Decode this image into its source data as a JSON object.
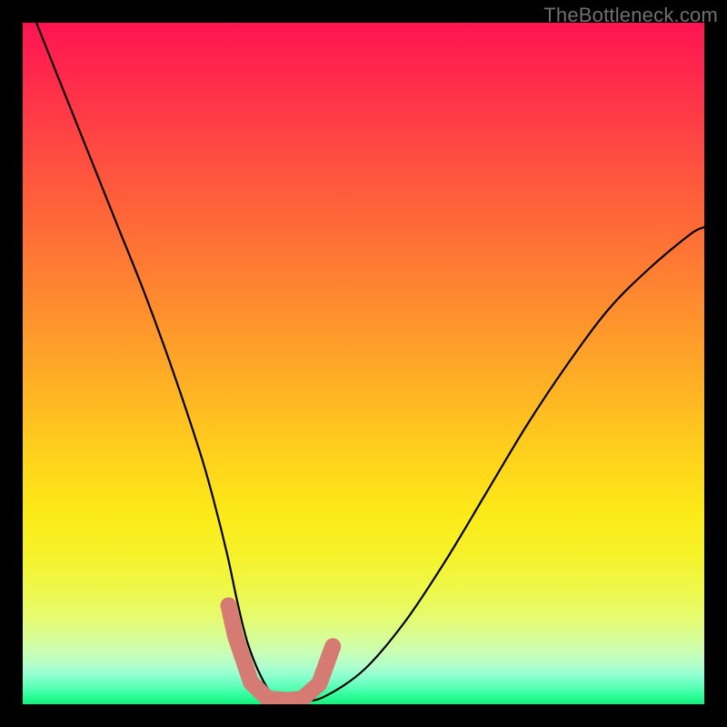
{
  "watermark": "TheBottleneck.com",
  "chart_data": {
    "type": "line",
    "title": "",
    "xlabel": "",
    "ylabel": "",
    "xlim": [
      0,
      100
    ],
    "ylim": [
      0,
      100
    ],
    "series": [
      {
        "name": "bottleneck-curve",
        "x": [
          2,
          6,
          10,
          14,
          18,
          22,
          26,
          28,
          30,
          31.5,
          33,
          35,
          37,
          39,
          40.5,
          44,
          50,
          56,
          62,
          68,
          74,
          80,
          86,
          92,
          98,
          100
        ],
        "y": [
          100,
          90,
          80,
          70,
          60,
          49,
          37,
          30,
          22,
          15,
          9,
          4,
          1,
          0.5,
          0.5,
          1,
          5,
          12,
          21,
          31,
          41,
          50,
          58,
          64,
          69,
          70
        ]
      }
    ],
    "highlight_region": {
      "name": "optimal-range",
      "points_xy": [
        [
          30.2,
          14.5
        ],
        [
          31.2,
          10.0
        ],
        [
          33.5,
          3.2
        ],
        [
          36.0,
          0.8
        ],
        [
          39.0,
          0.6
        ],
        [
          41.0,
          0.8
        ],
        [
          43.5,
          3.0
        ],
        [
          45.5,
          8.5
        ]
      ]
    },
    "gradient_stops": [
      {
        "pos": 0.0,
        "color": "#ff1452"
      },
      {
        "pos": 0.3,
        "color": "#ff6b37"
      },
      {
        "pos": 0.64,
        "color": "#ffd31b"
      },
      {
        "pos": 0.9,
        "color": "#d9fd93"
      },
      {
        "pos": 1.0,
        "color": "#14f07c"
      }
    ]
  }
}
